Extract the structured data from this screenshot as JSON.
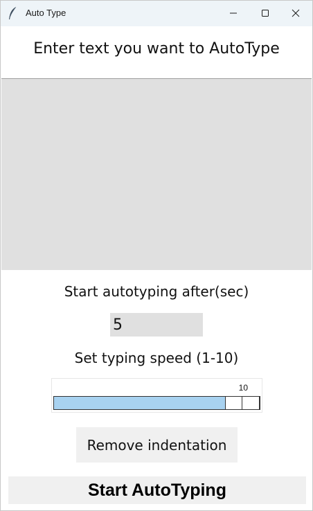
{
  "window": {
    "title": "Auto Type",
    "app_icon": "feather-icon"
  },
  "heading": "Enter text you want to AutoType",
  "text_area": {
    "value": ""
  },
  "delay": {
    "label": "Start autotyping after(sec)",
    "value": "5"
  },
  "speed": {
    "label": "Set typing speed (1-10)",
    "value": "10",
    "min": 1,
    "max": 10,
    "current": 10
  },
  "buttons": {
    "remove_indent": "Remove indentation",
    "start": "Start AutoTyping"
  },
  "colors": {
    "titlebar": "#eef4f8",
    "field_bg": "#e0e0e0",
    "scale_fill": "#a8d2f0",
    "button_bg": "#f0f0f0"
  }
}
